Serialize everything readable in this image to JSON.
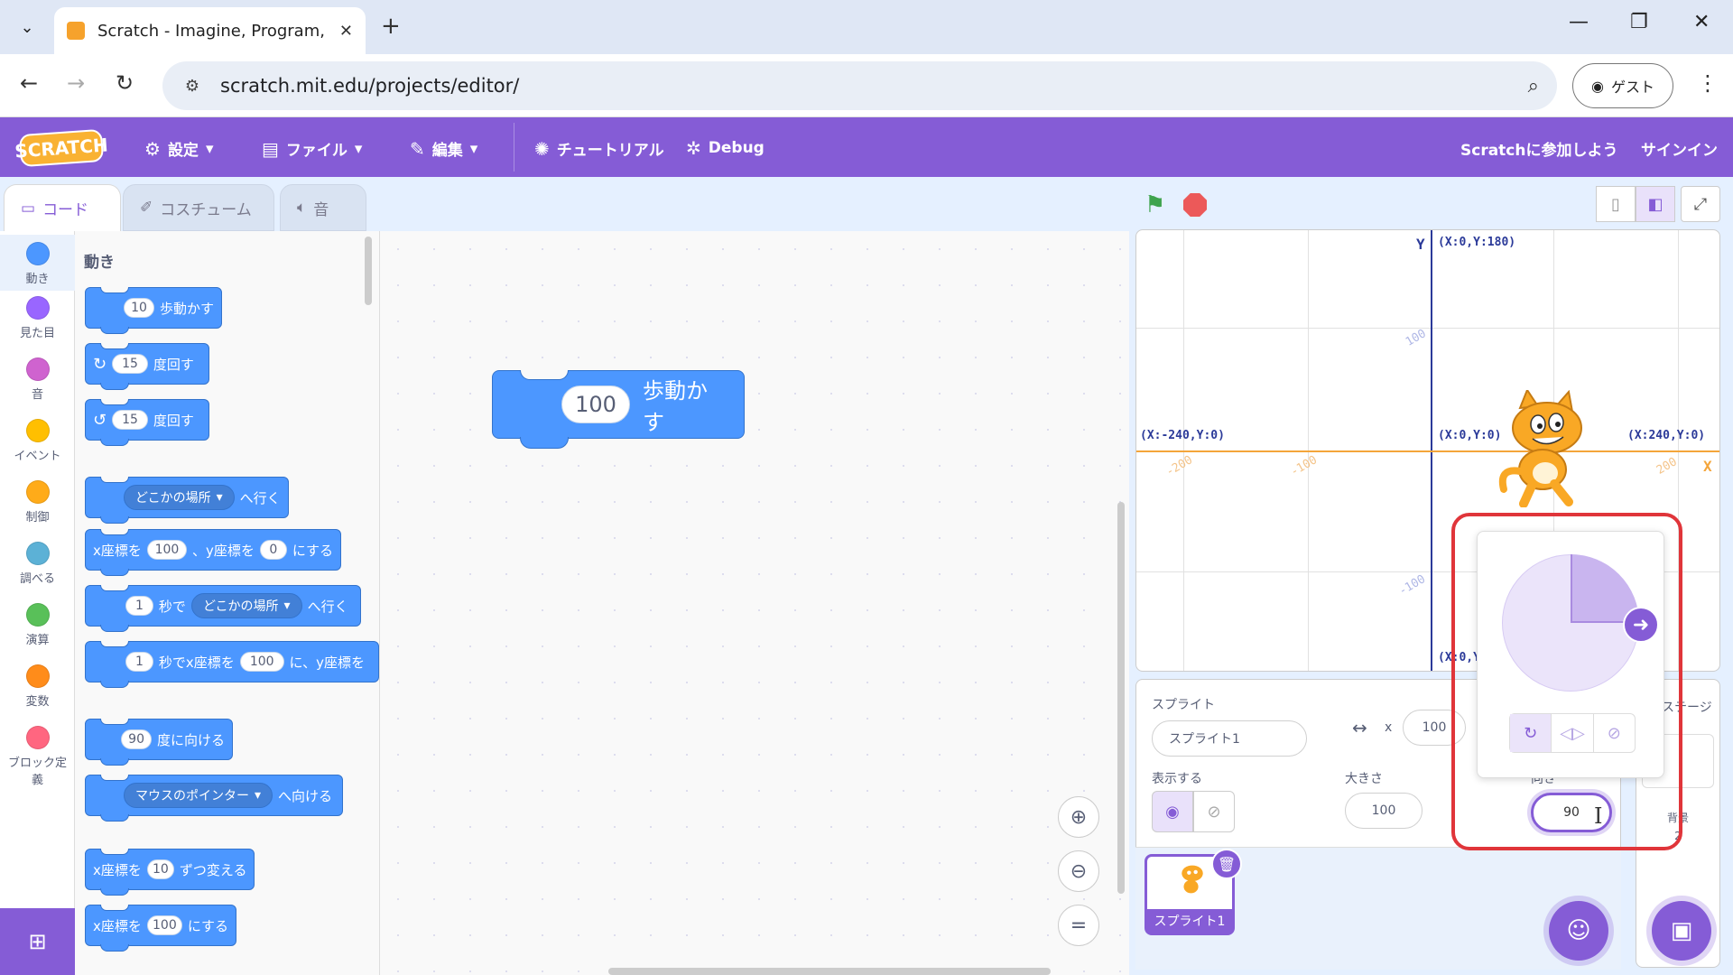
{
  "browser": {
    "tab_title": "Scratch - Imagine, Program, Sha",
    "url": "scratch.mit.edu/projects/editor/",
    "guest_label": "ゲスト"
  },
  "menubar": {
    "logo": "SCRATCH",
    "settings": "設定",
    "file": "ファイル",
    "edit": "編集",
    "tutorials": "チュートリアル",
    "debug": "Debug",
    "join": "Scratchに参加しよう",
    "signin": "サインイン"
  },
  "tabs": {
    "code": "コード",
    "costumes": "コスチューム",
    "sounds": "音"
  },
  "categories": [
    {
      "label": "動き",
      "color": "#4c97ff"
    },
    {
      "label": "見た目",
      "color": "#9966ff"
    },
    {
      "label": "音",
      "color": "#cf63cf"
    },
    {
      "label": "イベント",
      "color": "#ffbf00"
    },
    {
      "label": "制御",
      "color": "#ffab19"
    },
    {
      "label": "調べる",
      "color": "#5cb1d6"
    },
    {
      "label": "演算",
      "color": "#59c059"
    },
    {
      "label": "変数",
      "color": "#ff8c1a"
    },
    {
      "label": "ブロック定義",
      "color": "#ff6680"
    }
  ],
  "flyout": {
    "title": "動き",
    "b1": {
      "v": "10",
      "t": "歩動かす"
    },
    "b2": {
      "v": "15",
      "t": "度回す"
    },
    "b3": {
      "v": "15",
      "t": "度回す"
    },
    "b4": {
      "d": "どこかの場所",
      "t": "へ行く"
    },
    "b5": {
      "a": "x座標を",
      "v1": "100",
      "b": "、y座標を",
      "v2": "0",
      "c": "にする"
    },
    "b6": {
      "v": "1",
      "a": "秒で",
      "d": "どこかの場所",
      "t": "へ行く"
    },
    "b7": {
      "v": "1",
      "a": "秒でx座標を",
      "v2": "100",
      "b": "に、y座標を"
    },
    "b8": {
      "v": "90",
      "t": "度に向ける"
    },
    "b9": {
      "d": "マウスのポインター",
      "t": "へ向ける"
    },
    "b10": {
      "a": "x座標を",
      "v": "10",
      "t": "ずつ変える"
    },
    "b11": {
      "a": "x座標を",
      "v": "100",
      "t": "にする"
    }
  },
  "workspace_block": {
    "value": "100",
    "label": "歩動かす"
  },
  "stage": {
    "top": "(X:0,Y:180)",
    "left": "(X:-240,Y:0)",
    "center": "(X:0,Y:0)",
    "right": "(X:240,Y:0)",
    "bottom": "(X:0,Y",
    "y_label": "Y",
    "x_label": "X",
    "ticks": {
      "y100": "100",
      "yn100": "-100",
      "xn200": "-200",
      "xn100": "-100",
      "x200": "200"
    }
  },
  "sprite_info": {
    "sprite_label": "スプライト",
    "sprite_name": "スプライト1",
    "x_label": "x",
    "x_value": "100",
    "show_label": "表示する",
    "size_label": "大きさ",
    "size_value": "100",
    "direction_label": "向き",
    "direction_value": "90"
  },
  "sprite_list": {
    "thumb_name": "スプライト1"
  },
  "stage_pane": {
    "label": "ステージ",
    "bg_label": "背景",
    "bg_count": "2"
  }
}
